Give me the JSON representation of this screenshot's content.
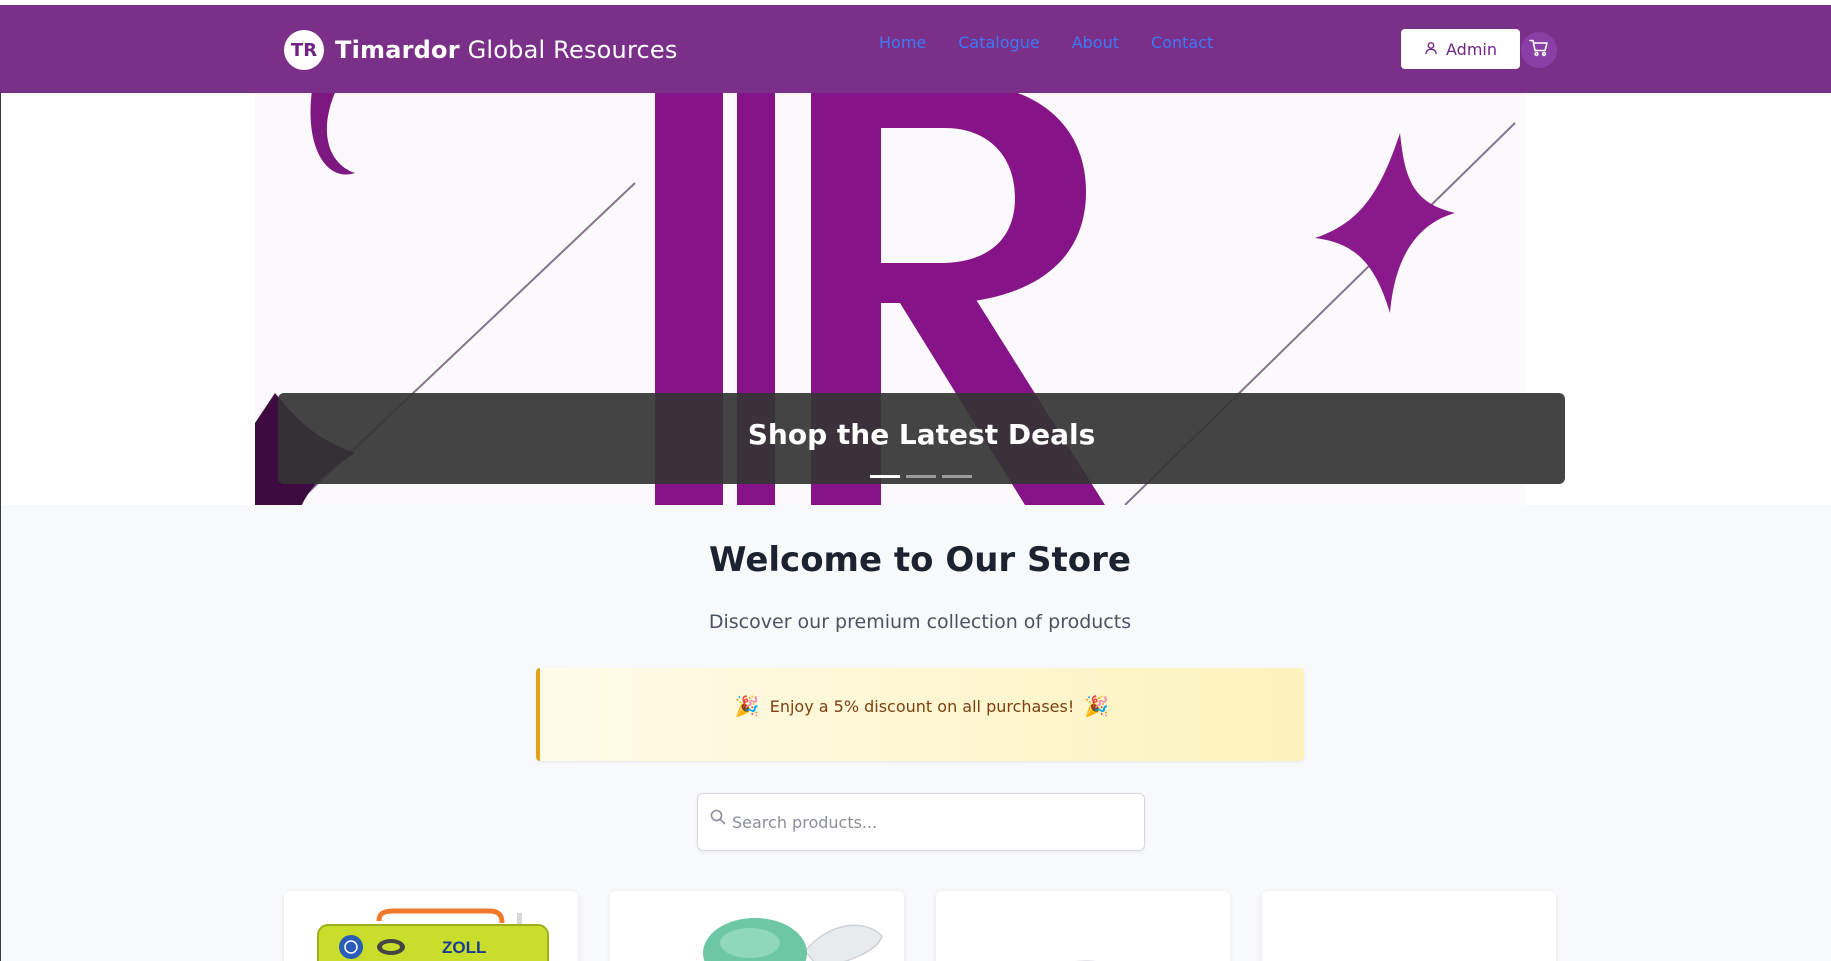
{
  "header": {
    "logo_initials": "TR",
    "brand_bold": "Timardor",
    "brand_light": "Global Resources",
    "nav": [
      "Home",
      "Catalogue",
      "About",
      "Contact"
    ],
    "admin_label": "Admin"
  },
  "hero": {
    "caption": "Shop the Latest Deals",
    "slides_total": 3,
    "active_slide": 1
  },
  "main": {
    "title": "Welcome to Our Store",
    "subtitle": "Discover our premium collection of products",
    "promo": {
      "emoji_left": "🎉",
      "text": "Enjoy a 5% discount on all purchases!",
      "emoji_right": "🎉"
    },
    "search": {
      "placeholder": "Search products..."
    },
    "products": [
      {
        "image": "defibrillator",
        "label_on_image": "ZOLL"
      },
      {
        "image": "bag-valve-mask"
      },
      {
        "image": "clear-oxygen-mask"
      },
      {
        "image": "blank"
      }
    ]
  },
  "colors": {
    "header_purple": "#752684",
    "nav_link": "#3b7bf6",
    "promo_border": "#e3a21a",
    "promo_text": "#7b3f10"
  }
}
